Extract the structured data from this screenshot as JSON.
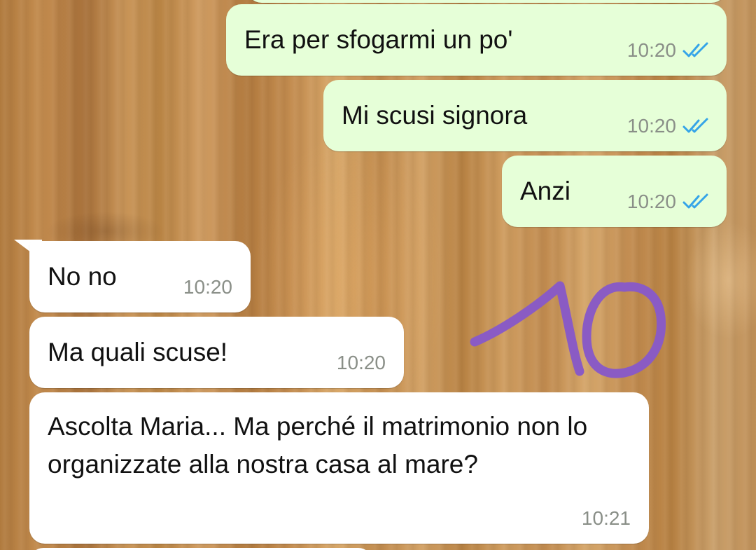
{
  "chat": {
    "messages": [
      {
        "direction": "outgoing",
        "text": "Era per sfogarmi un po'",
        "time": "10:20",
        "status_icon": "double-check-read-icon"
      },
      {
        "direction": "outgoing",
        "text": "Mi scusi signora",
        "time": "10:20",
        "status_icon": "double-check-read-icon"
      },
      {
        "direction": "outgoing",
        "text": "Anzi",
        "time": "10:20",
        "status_icon": "double-check-read-icon"
      },
      {
        "direction": "incoming",
        "text": "No no",
        "time": "10:20"
      },
      {
        "direction": "incoming",
        "text": "Ma quali scuse!",
        "time": "10:20"
      },
      {
        "direction": "incoming",
        "text": "Ascolta Maria... Ma perché il matrimonio non lo organizzate alla nostra casa al mare?",
        "time": "10:21"
      }
    ]
  },
  "annotation": {
    "text": "10",
    "color": "#8a5bc4"
  },
  "colors": {
    "outgoing_bubble": "#e6ffd8",
    "incoming_bubble": "#ffffff",
    "read_tick": "#35a4e8",
    "timestamp": "#8a8f88"
  }
}
